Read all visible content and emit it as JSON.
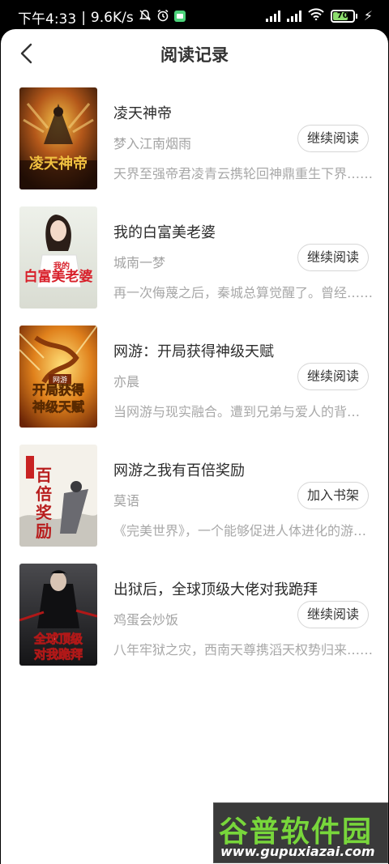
{
  "status_bar": {
    "time": "下午4:33",
    "speed": "9.6K/s",
    "battery": "70"
  },
  "header": {
    "title": "阅读记录"
  },
  "books": [
    {
      "title": "凌天神帝",
      "author": "梦入江南烟雨",
      "action": "继续阅读",
      "desc": "天界至强帝君凌青云携轮回神鼎重生下界……"
    },
    {
      "title": "我的白富美老婆",
      "author": "城南一梦",
      "action": "继续阅读",
      "desc": "再一次侮蔑之后，秦城总算觉醒了。曾经……"
    },
    {
      "title": "网游：开局获得神级天赋",
      "author": "亦晨",
      "action": "继续阅读",
      "desc": "当网游与现实融合。遭到兄弟与爱人的背叛……"
    },
    {
      "title": "网游之我有百倍奖励",
      "author": "莫语",
      "action": "加入书架",
      "desc": "《完美世界》，一个能够促进人体进化的游戏……"
    },
    {
      "title": "出狱后，全球顶级大佬对我跪拜",
      "author": "鸡蛋会炒饭",
      "action": "继续阅读",
      "desc": "八年牢狱之灾，西南天尊携滔天权势归来……"
    }
  ],
  "watermark": {
    "logo": "谷普软件园",
    "url": "www.gupuxiazai.com"
  }
}
